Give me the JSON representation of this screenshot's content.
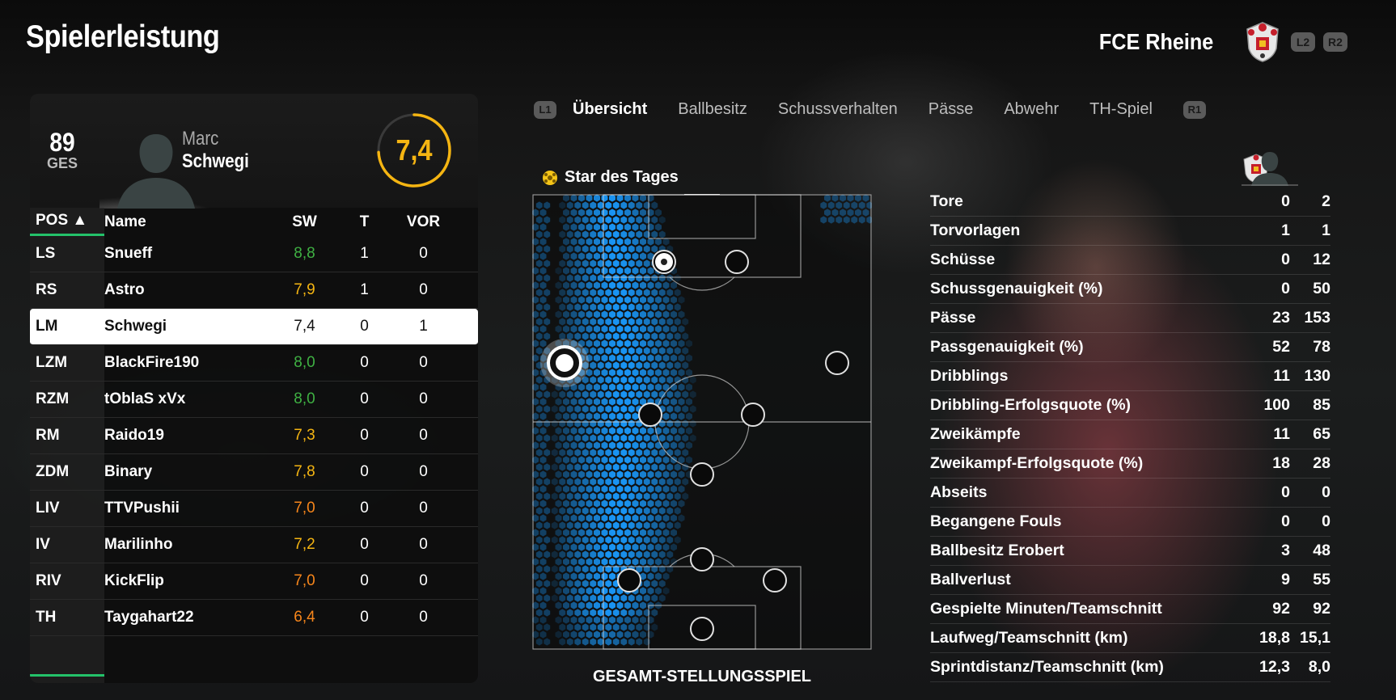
{
  "header": {
    "title": "Spielerleistung",
    "team_name": "FCE Rheine",
    "l2": "L2",
    "r2": "R2"
  },
  "player": {
    "ovr": "89",
    "ovr_label": "GES",
    "first_name": "Marc",
    "last_name": "Schwegi",
    "rating": "7,4",
    "rating_value": 7.4
  },
  "table": {
    "headers": {
      "pos": "POS ▲",
      "name": "Name",
      "sw": "SW",
      "t": "T",
      "vor": "VOR"
    },
    "rows": [
      {
        "pos": "LS",
        "name": "Snueff",
        "sw": "8,8",
        "t": "1",
        "vor": "0",
        "color": "#3fb143",
        "star": true
      },
      {
        "pos": "RS",
        "name": "Astro",
        "sw": "7,9",
        "t": "1",
        "vor": "0",
        "color": "#f5b512"
      },
      {
        "pos": "LM",
        "name": "Schwegi",
        "sw": "7,4",
        "t": "0",
        "vor": "1",
        "selected": true
      },
      {
        "pos": "LZM",
        "name": "BlackFire190",
        "sw": "8,0",
        "t": "0",
        "vor": "0",
        "color": "#3fb143"
      },
      {
        "pos": "RZM",
        "name": "tOblaS xVx",
        "sw": "8,0",
        "t": "0",
        "vor": "0",
        "color": "#3fb143"
      },
      {
        "pos": "RM",
        "name": "Raido19",
        "sw": "7,3",
        "t": "0",
        "vor": "0",
        "color": "#f5b512"
      },
      {
        "pos": "ZDM",
        "name": "Binary",
        "sw": "7,8",
        "t": "0",
        "vor": "0",
        "color": "#f5b512"
      },
      {
        "pos": "LIV",
        "name": "TTVPushii",
        "sw": "7,0",
        "t": "0",
        "vor": "0",
        "color": "#f7861b"
      },
      {
        "pos": "IV",
        "name": "Marilinho",
        "sw": "7,2",
        "t": "0",
        "vor": "0",
        "color": "#f5b512"
      },
      {
        "pos": "RIV",
        "name": "KickFlip",
        "sw": "7,0",
        "t": "0",
        "vor": "0",
        "color": "#f7861b"
      },
      {
        "pos": "TH",
        "name": "Taygahart22",
        "sw": "6,4",
        "t": "0",
        "vor": "0",
        "color": "#f7861b"
      }
    ]
  },
  "tabs": {
    "l1": "L1",
    "r1": "R1",
    "items": [
      "Übersicht",
      "Ballbesitz",
      "Schussverhalten",
      "Pässe",
      "Abwehr",
      "TH-Spiel"
    ]
  },
  "pitch": {
    "star_label": "Star des Tages",
    "caption": "GESAMT-STELLUNGSSPIEL"
  },
  "stats": [
    {
      "label": "Tore",
      "player": "0",
      "team": "2"
    },
    {
      "label": "Torvorlagen",
      "player": "1",
      "team": "1"
    },
    {
      "label": "Schüsse",
      "player": "0",
      "team": "12"
    },
    {
      "label": "Schussgenauigkeit (%)",
      "player": "0",
      "team": "50"
    },
    {
      "label": "Pässe",
      "player": "23",
      "team": "153"
    },
    {
      "label": "Passgenauigkeit (%)",
      "player": "52",
      "team": "78"
    },
    {
      "label": "Dribblings",
      "player": "11",
      "team": "130"
    },
    {
      "label": "Dribbling-Erfolgsquote (%)",
      "player": "100",
      "team": "85"
    },
    {
      "label": "Zweikämpfe",
      "player": "11",
      "team": "65"
    },
    {
      "label": "Zweikampf-Erfolgsquote (%)",
      "player": "18",
      "team": "28"
    },
    {
      "label": "Abseits",
      "player": "0",
      "team": "0"
    },
    {
      "label": "Begangene Fouls",
      "player": "0",
      "team": "0"
    },
    {
      "label": "Ballbesitz Erobert",
      "player": "3",
      "team": "48"
    },
    {
      "label": "Ballverlust",
      "player": "9",
      "team": "55"
    },
    {
      "label": "Gespielte Minuten/Teamschnitt",
      "player": "92",
      "team": "92"
    },
    {
      "label": "Laufweg/Teamschnitt (km)",
      "player": "18,8",
      "team": "15,1"
    },
    {
      "label": "Sprintdistanz/Teamschnitt (km)",
      "player": "12,3",
      "team": "8,0"
    }
  ],
  "colors": {
    "accent_green": "#24c26a",
    "rating_gold": "#f5b512",
    "heat_blue": "#1a9bff"
  }
}
